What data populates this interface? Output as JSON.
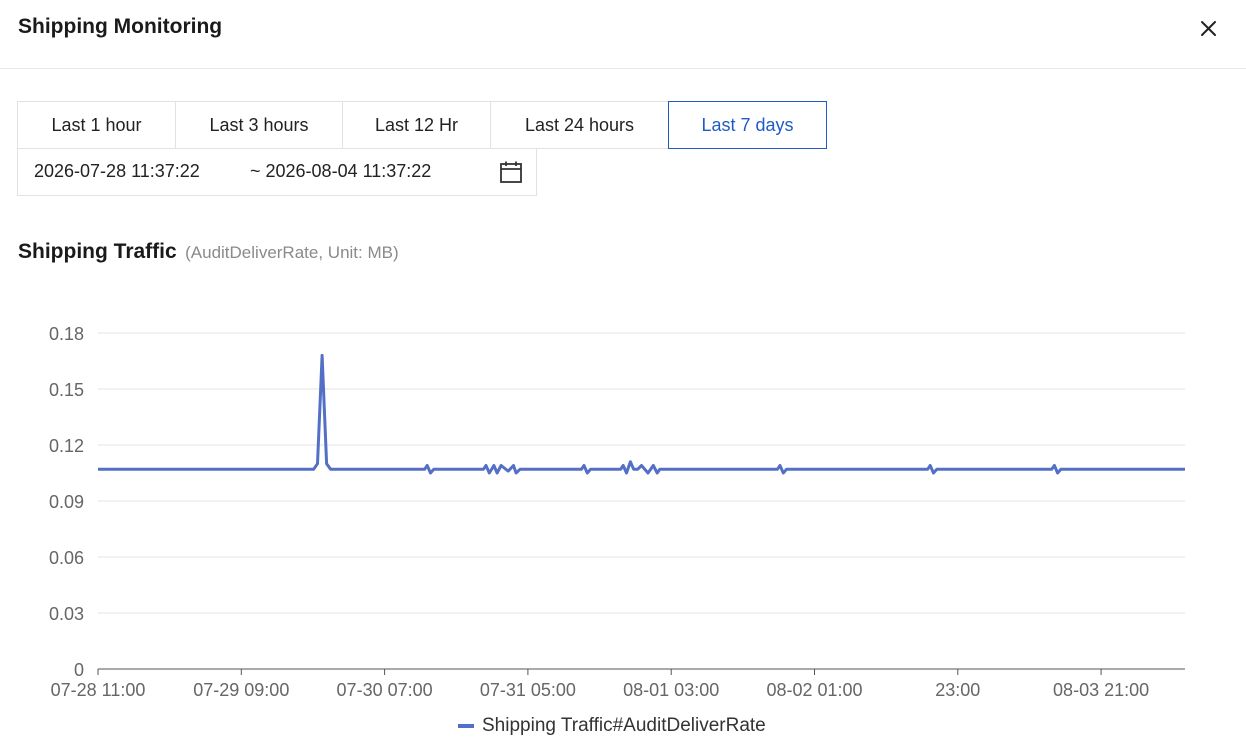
{
  "header": {
    "title": "Shipping Monitoring",
    "close_icon": "close-icon"
  },
  "ranges": {
    "items": [
      "Last 1 hour",
      "Last 3 hours",
      "Last 12 Hr",
      "Last 24 hours",
      "Last 7 days"
    ],
    "active": "Last 7 days"
  },
  "date_range": {
    "start": "2026-07-28 11:37:22",
    "end": "~ 2026-08-04 11:37:22",
    "icon": "calendar-icon"
  },
  "chart_section": {
    "title": "Shipping Traffic",
    "subtitle": "(AuditDeliverRate, Unit: MB)"
  },
  "colors": {
    "accent": "#1e5cc5",
    "series": "#5470c6",
    "grid": "#e3e3e3"
  },
  "chart_data": {
    "type": "line",
    "xlabel": "",
    "ylabel": "",
    "ylim": [
      0,
      0.18
    ],
    "yticks": [
      "0",
      "0.03",
      "0.06",
      "0.09",
      "0.12",
      "0.15",
      "0.18"
    ],
    "xtick_labels": [
      "07-28 11:00",
      "07-29 09:00",
      "07-30 07:00",
      "07-31 05:00",
      "08-01 03:00",
      "08-02 01:00",
      "23:00",
      "08-03 21:00"
    ],
    "x_unit": "hours since 07-28 11:00",
    "x_range": [
      0,
      166.4
    ],
    "grid": true,
    "legend": "bottom-center",
    "series": [
      {
        "name": "Shipping Traffic#AuditDeliverRate",
        "points": [
          [
            0,
            0.107
          ],
          [
            33,
            0.107
          ],
          [
            33.6,
            0.11
          ],
          [
            34.3,
            0.168
          ],
          [
            35.0,
            0.11
          ],
          [
            35.6,
            0.107
          ],
          [
            50,
            0.107
          ],
          [
            50.4,
            0.109
          ],
          [
            50.9,
            0.105
          ],
          [
            51.4,
            0.107
          ],
          [
            59,
            0.107
          ],
          [
            59.4,
            0.109
          ],
          [
            59.9,
            0.105
          ],
          [
            60.6,
            0.109
          ],
          [
            61.1,
            0.105
          ],
          [
            61.7,
            0.109
          ],
          [
            62.8,
            0.106
          ],
          [
            63.6,
            0.109
          ],
          [
            64.0,
            0.105
          ],
          [
            64.6,
            0.107
          ],
          [
            74,
            0.107
          ],
          [
            74.4,
            0.109
          ],
          [
            74.9,
            0.105
          ],
          [
            75.4,
            0.107
          ],
          [
            80,
            0.107
          ],
          [
            80.4,
            0.109
          ],
          [
            80.9,
            0.105
          ],
          [
            81.5,
            0.111
          ],
          [
            82.0,
            0.107
          ],
          [
            82.6,
            0.107
          ],
          [
            83.2,
            0.109
          ],
          [
            84.2,
            0.105
          ],
          [
            85.0,
            0.109
          ],
          [
            85.6,
            0.105
          ],
          [
            86.0,
            0.107
          ],
          [
            104,
            0.107
          ],
          [
            104.4,
            0.109
          ],
          [
            104.9,
            0.105
          ],
          [
            105.4,
            0.107
          ],
          [
            127,
            0.107
          ],
          [
            127.4,
            0.109
          ],
          [
            127.9,
            0.105
          ],
          [
            128.4,
            0.107
          ],
          [
            146,
            0.107
          ],
          [
            146.4,
            0.109
          ],
          [
            146.9,
            0.105
          ],
          [
            147.4,
            0.107
          ],
          [
            166.4,
            0.107
          ]
        ]
      }
    ]
  }
}
